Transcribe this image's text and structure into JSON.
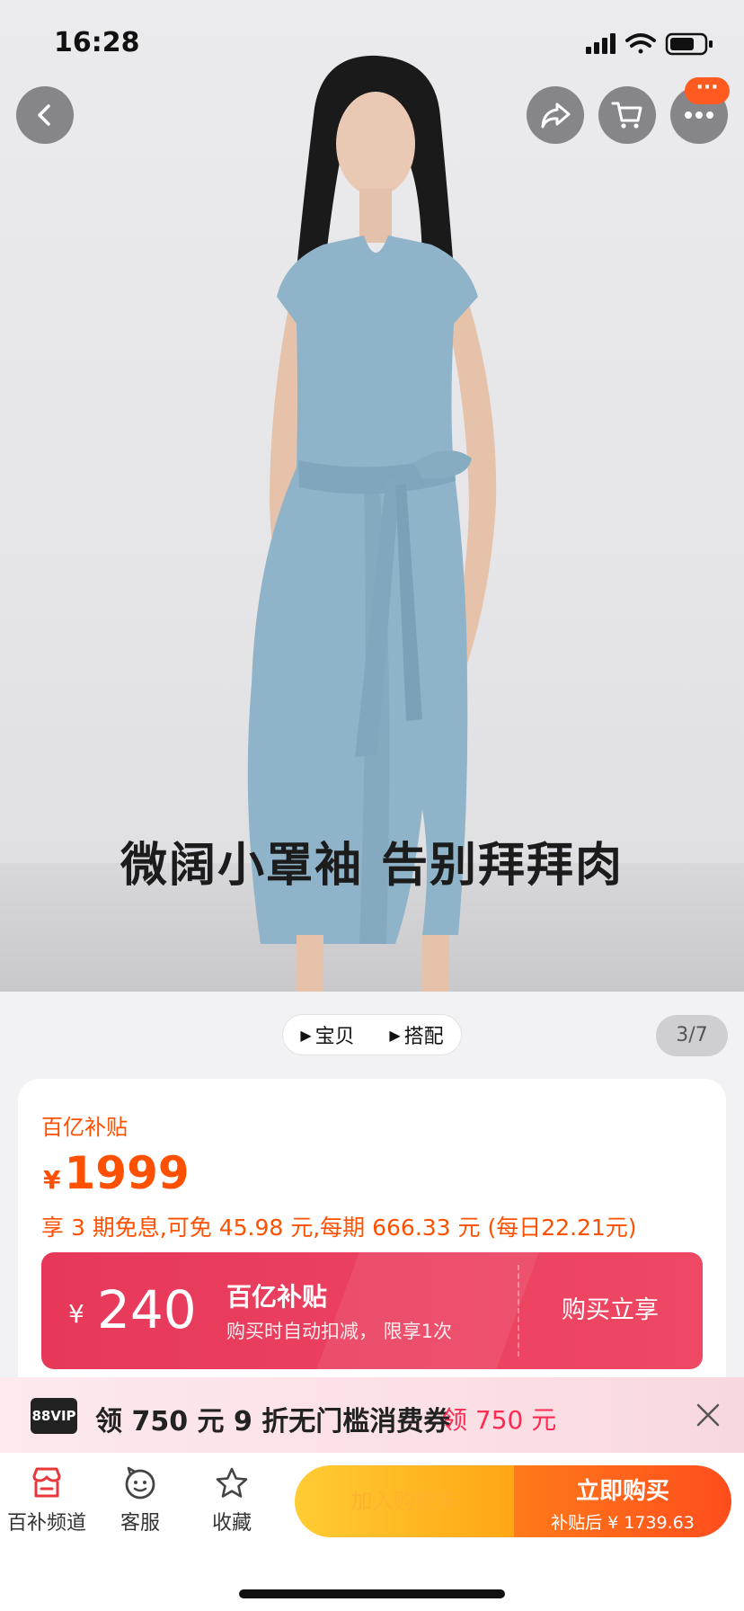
{
  "status_bar": {
    "time": "16:28"
  },
  "hero": {
    "caption": "微阔小罩袖 告别拜拜肉",
    "badge": "···"
  },
  "media_tabs": [
    {
      "label": "宝贝"
    },
    {
      "label": "搭配"
    }
  ],
  "gallery": {
    "counter": "3/7"
  },
  "price": {
    "tag": "百亿补贴",
    "currency": "¥",
    "amount": "1999",
    "installment": "享 3 期免息,可免 45.98 元,每期 666.33 元 (每日22.21元)"
  },
  "coupon": {
    "currency": "¥",
    "amount": "240",
    "title": "百亿补贴",
    "desc": "购买时自动扣减， 限享1次",
    "cta": "购买立享"
  },
  "vip": {
    "badge": "88VIP",
    "text": "领 750 元 9 折无门槛消费券",
    "highlight": "领 750 元"
  },
  "bottom_nav": {
    "channel": "百补频道",
    "service": "客服",
    "favorite": "收藏",
    "add_cart": "加入购物车",
    "buy_now": "立即购买",
    "buy_sub": "补贴后 ¥ 1739.63"
  },
  "colors": {
    "accent": "#ff5000",
    "coupon_red": "#e7385a",
    "buy_orange": "#ff5a1c",
    "cart_yellow": "#ffb91f"
  }
}
